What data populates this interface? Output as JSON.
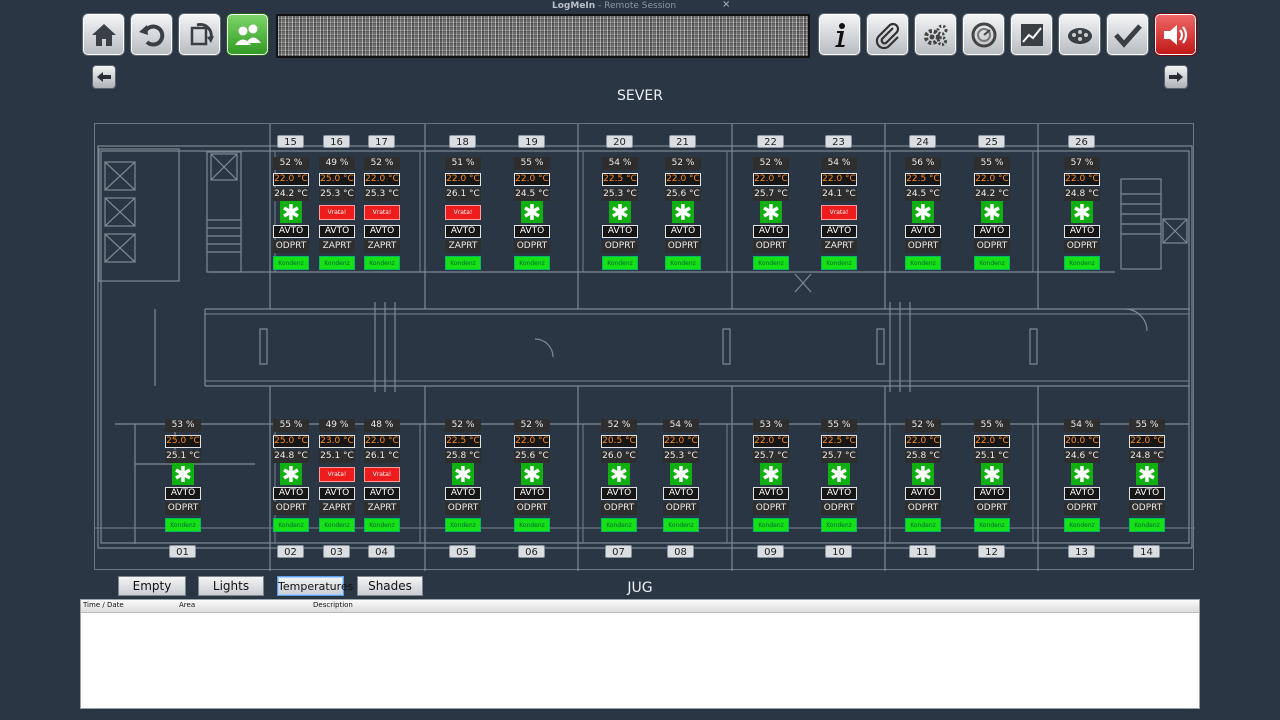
{
  "session": {
    "name": "LogMeIn",
    "suffix": "Remote Session",
    "close": "×"
  },
  "toolbar_left": [
    {
      "id": "home",
      "icon": "home-icon"
    },
    {
      "id": "undo",
      "icon": "undo-icon"
    },
    {
      "id": "refresh",
      "icon": "refresh-icon"
    },
    {
      "id": "users",
      "icon": "users-icon",
      "active": true
    }
  ],
  "toolbar_right": [
    {
      "id": "info",
      "icon": "info-icon"
    },
    {
      "id": "attach",
      "icon": "paperclip-icon"
    },
    {
      "id": "settings",
      "icon": "gears-icon"
    },
    {
      "id": "gauge",
      "icon": "gauge-icon"
    },
    {
      "id": "chart",
      "icon": "chart-icon"
    },
    {
      "id": "film",
      "icon": "film-reel-icon"
    },
    {
      "id": "confirm",
      "icon": "checkmark-icon"
    },
    {
      "id": "sound",
      "icon": "speaker-icon",
      "alarm": true
    }
  ],
  "headings": {
    "north": "SEVER",
    "south": "JUG"
  },
  "north_rooms": [
    {
      "number": "15",
      "humidity": "52 %",
      "setpoint": "22.0 °C",
      "actual": "24.2 °C",
      "status": "snow",
      "mode": "AVTO",
      "window": "ODPRT",
      "label": "Kondenz"
    },
    {
      "number": "16",
      "humidity": "49 %",
      "setpoint": "25.0 °C",
      "actual": "25.3 °C",
      "status": "alarm",
      "alarm_text": "Vrata!",
      "mode": "AVTO",
      "window": "ZAPRT",
      "label": "Kondenz"
    },
    {
      "number": "17",
      "humidity": "52 %",
      "setpoint": "22.0 °C",
      "actual": "25.3 °C",
      "status": "alarm",
      "alarm_text": "Vrata!",
      "mode": "AVTO",
      "window": "ZAPRT",
      "label": "Kondenz"
    },
    {
      "number": "18",
      "humidity": "51 %",
      "setpoint": "22.0 °C",
      "actual": "26.1 °C",
      "status": "alarm",
      "alarm_text": "Vrata!",
      "mode": "AVTO",
      "window": "ZAPRT",
      "label": "Kondenz"
    },
    {
      "number": "19",
      "humidity": "55 %",
      "setpoint": "22.0 °C",
      "actual": "24.5 °C",
      "status": "snow",
      "mode": "AVTO",
      "window": "ODPRT",
      "label": "Kondenz"
    },
    {
      "number": "20",
      "humidity": "54 %",
      "setpoint": "22.5 °C",
      "actual": "25.3 °C",
      "status": "snow",
      "mode": "AVTO",
      "window": "ODPRT",
      "label": "Kondenz"
    },
    {
      "number": "21",
      "humidity": "52 %",
      "setpoint": "22.0 °C",
      "actual": "25.6 °C",
      "status": "snow",
      "mode": "AVTO",
      "window": "ODPRT",
      "label": "Kondenz"
    },
    {
      "number": "22",
      "humidity": "52 %",
      "setpoint": "22.0 °C",
      "actual": "25.7 °C",
      "status": "snow",
      "mode": "AVTO",
      "window": "ODPRT",
      "label": "Kondenz"
    },
    {
      "number": "23",
      "humidity": "54 %",
      "setpoint": "22.0 °C",
      "actual": "24.1 °C",
      "status": "alarm",
      "alarm_text": "Vrata!",
      "mode": "AVTO",
      "window": "ZAPRT",
      "label": "Kondenz"
    },
    {
      "number": "24",
      "humidity": "56 %",
      "setpoint": "22.5 °C",
      "actual": "24.5 °C",
      "status": "snow",
      "mode": "AVTO",
      "window": "ODPRT",
      "label": "Kondenz"
    },
    {
      "number": "25",
      "humidity": "55 %",
      "setpoint": "22.0 °C",
      "actual": "24.2 °C",
      "status": "snow",
      "mode": "AVTO",
      "window": "ODPRT",
      "label": "Kondenz"
    },
    {
      "number": "26",
      "humidity": "57 %",
      "setpoint": "22.0 °C",
      "actual": "24.8 °C",
      "status": "snow",
      "mode": "AVTO",
      "window": "ODPRT",
      "label": "Kondenz"
    }
  ],
  "south_rooms": [
    {
      "number": "01",
      "humidity": "53 %",
      "setpoint": "25.0 °C",
      "actual": "25.1 °C",
      "status": "snow",
      "mode": "AVTO",
      "window": "ODPRT",
      "label": "Kondenz"
    },
    {
      "number": "02",
      "humidity": "55 %",
      "setpoint": "25.0 °C",
      "actual": "24.8 °C",
      "status": "snow",
      "mode": "AVTO",
      "window": "ODPRT",
      "label": "Kondenz"
    },
    {
      "number": "03",
      "humidity": "49 %",
      "setpoint": "23.0 °C",
      "actual": "25.1 °C",
      "status": "alarm",
      "alarm_text": "Vrata!",
      "mode": "AVTO",
      "window": "ZAPRT",
      "label": "Kondenz"
    },
    {
      "number": "04",
      "humidity": "48 %",
      "setpoint": "22.0 °C",
      "actual": "26.1 °C",
      "status": "alarm",
      "alarm_text": "Vrata!",
      "mode": "AVTO",
      "window": "ZAPRT",
      "label": "Kondenz"
    },
    {
      "number": "05",
      "humidity": "52 %",
      "setpoint": "22.5 °C",
      "actual": "25.8 °C",
      "status": "snow",
      "mode": "AVTO",
      "window": "ODPRT",
      "label": "Kondenz"
    },
    {
      "number": "06",
      "humidity": "52 %",
      "setpoint": "22.0 °C",
      "actual": "25.6 °C",
      "status": "snow",
      "mode": "AVTO",
      "window": "ODPRT",
      "label": "Kondenz"
    },
    {
      "number": "07",
      "humidity": "52 %",
      "setpoint": "20.5 °C",
      "actual": "26.0 °C",
      "status": "snow",
      "mode": "AVTO",
      "window": "ODPRT",
      "label": "Kondenz"
    },
    {
      "number": "08",
      "humidity": "54 %",
      "setpoint": "22.0 °C",
      "actual": "25.3 °C",
      "status": "snow",
      "mode": "AVTO",
      "window": "ODPRT",
      "label": "Kondenz"
    },
    {
      "number": "09",
      "humidity": "53 %",
      "setpoint": "22.0 °C",
      "actual": "25.7 °C",
      "status": "snow",
      "mode": "AVTO",
      "window": "ODPRT",
      "label": "Kondenz"
    },
    {
      "number": "10",
      "humidity": "55 %",
      "setpoint": "22.5 °C",
      "actual": "25.7 °C",
      "status": "snow",
      "mode": "AVTO",
      "window": "ODPRT",
      "label": "Kondenz"
    },
    {
      "number": "11",
      "humidity": "52 %",
      "setpoint": "22.0 °C",
      "actual": "25.8 °C",
      "status": "snow",
      "mode": "AVTO",
      "window": "ODPRT",
      "label": "Kondenz"
    },
    {
      "number": "12",
      "humidity": "55 %",
      "setpoint": "22.0 °C",
      "actual": "25.1 °C",
      "status": "snow",
      "mode": "AVTO",
      "window": "ODPRT",
      "label": "Kondenz"
    },
    {
      "number": "13",
      "humidity": "54 %",
      "setpoint": "20.0 °C",
      "actual": "24.6 °C",
      "status": "snow",
      "mode": "AVTO",
      "window": "ODPRT",
      "label": "Kondenz"
    },
    {
      "number": "14",
      "humidity": "55 %",
      "setpoint": "22.0 °C",
      "actual": "24.8 °C",
      "status": "snow",
      "mode": "AVTO",
      "window": "ODPRT",
      "label": "Kondenz"
    }
  ],
  "snow_symbol": "✱",
  "tabs": [
    {
      "label": "Empty"
    },
    {
      "label": "Lights"
    },
    {
      "label": "Temperatures",
      "active": true
    },
    {
      "label": "Shades"
    }
  ],
  "log": {
    "columns": [
      "Time / Date",
      "Area",
      "Description"
    ],
    "rows": []
  },
  "colors": {
    "background": "#2b3645",
    "snow": "#10b010",
    "alarm": "#ee1c1c",
    "kondenz": "#16e016",
    "setpoint_text": "#ff8c1a",
    "sound_button": "#c01616",
    "users_button": "#2f9a22"
  }
}
